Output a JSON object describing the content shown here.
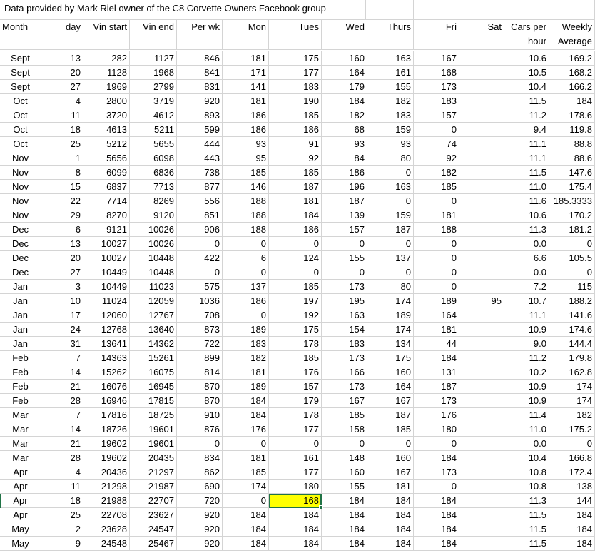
{
  "sheet": {
    "title": "Data provided by Mark Riel owner of the C8 Corvette Owners Facebook group",
    "headers": [
      "Month",
      "day",
      "Vin start",
      "Vin end",
      "Per wk",
      "Mon",
      "Tues",
      "Wed",
      "Thurs",
      "Fri",
      "Sat",
      "Cars per",
      "Weekly"
    ],
    "headers2": [
      "",
      "",
      "",
      "",
      "",
      "",
      "",
      "",
      "",
      "",
      "",
      "hour",
      "Average"
    ],
    "rows": [
      [
        "Sept",
        "13",
        "282",
        "1127",
        "846",
        "181",
        "175",
        "160",
        "163",
        "167",
        "",
        "10.6",
        "169.2"
      ],
      [
        "Sept",
        "20",
        "1128",
        "1968",
        "841",
        "171",
        "177",
        "164",
        "161",
        "168",
        "",
        "10.5",
        "168.2"
      ],
      [
        "Sept",
        "27",
        "1969",
        "2799",
        "831",
        "141",
        "183",
        "179",
        "155",
        "173",
        "",
        "10.4",
        "166.2"
      ],
      [
        "Oct",
        "4",
        "2800",
        "3719",
        "920",
        "181",
        "190",
        "184",
        "182",
        "183",
        "",
        "11.5",
        "184"
      ],
      [
        "Oct",
        "11",
        "3720",
        "4612",
        "893",
        "186",
        "185",
        "182",
        "183",
        "157",
        "",
        "11.2",
        "178.6"
      ],
      [
        "Oct",
        "18",
        "4613",
        "5211",
        "599",
        "186",
        "186",
        "68",
        "159",
        "0",
        "",
        "9.4",
        "119.8"
      ],
      [
        "Oct",
        "25",
        "5212",
        "5655",
        "444",
        "93",
        "91",
        "93",
        "93",
        "74",
        "",
        "11.1",
        "88.8"
      ],
      [
        "Nov",
        "1",
        "5656",
        "6098",
        "443",
        "95",
        "92",
        "84",
        "80",
        "92",
        "",
        "11.1",
        "88.6"
      ],
      [
        "Nov",
        "8",
        "6099",
        "6836",
        "738",
        "185",
        "185",
        "186",
        "0",
        "182",
        "",
        "11.5",
        "147.6"
      ],
      [
        "Nov",
        "15",
        "6837",
        "7713",
        "877",
        "146",
        "187",
        "196",
        "163",
        "185",
        "",
        "11.0",
        "175.4"
      ],
      [
        "Nov",
        "22",
        "7714",
        "8269",
        "556",
        "188",
        "181",
        "187",
        "0",
        "0",
        "",
        "11.6",
        "185.3333"
      ],
      [
        "Nov",
        "29",
        "8270",
        "9120",
        "851",
        "188",
        "184",
        "139",
        "159",
        "181",
        "",
        "10.6",
        "170.2"
      ],
      [
        "Dec",
        "6",
        "9121",
        "10026",
        "906",
        "188",
        "186",
        "157",
        "187",
        "188",
        "",
        "11.3",
        "181.2"
      ],
      [
        "Dec",
        "13",
        "10027",
        "10026",
        "0",
        "0",
        "0",
        "0",
        "0",
        "0",
        "",
        "0.0",
        "0"
      ],
      [
        "Dec",
        "20",
        "10027",
        "10448",
        "422",
        "6",
        "124",
        "155",
        "137",
        "0",
        "",
        "6.6",
        "105.5"
      ],
      [
        "Dec",
        "27",
        "10449",
        "10448",
        "0",
        "0",
        "0",
        "0",
        "0",
        "0",
        "",
        "0.0",
        "0"
      ],
      [
        "Jan",
        "3",
        "10449",
        "11023",
        "575",
        "137",
        "185",
        "173",
        "80",
        "0",
        "",
        "7.2",
        "115"
      ],
      [
        "Jan",
        "10",
        "11024",
        "12059",
        "1036",
        "186",
        "197",
        "195",
        "174",
        "189",
        "95",
        "10.7",
        "188.2"
      ],
      [
        "Jan",
        "17",
        "12060",
        "12767",
        "708",
        "0",
        "192",
        "163",
        "189",
        "164",
        "",
        "11.1",
        "141.6"
      ],
      [
        "Jan",
        "24",
        "12768",
        "13640",
        "873",
        "189",
        "175",
        "154",
        "174",
        "181",
        "",
        "10.9",
        "174.6"
      ],
      [
        "Jan",
        "31",
        "13641",
        "14362",
        "722",
        "183",
        "178",
        "183",
        "134",
        "44",
        "",
        "9.0",
        "144.4"
      ],
      [
        "Feb",
        "7",
        "14363",
        "15261",
        "899",
        "182",
        "185",
        "173",
        "175",
        "184",
        "",
        "11.2",
        "179.8"
      ],
      [
        "Feb",
        "14",
        "15262",
        "16075",
        "814",
        "181",
        "176",
        "166",
        "160",
        "131",
        "",
        "10.2",
        "162.8"
      ],
      [
        "Feb",
        "21",
        "16076",
        "16945",
        "870",
        "189",
        "157",
        "173",
        "164",
        "187",
        "",
        "10.9",
        "174"
      ],
      [
        "Feb",
        "28",
        "16946",
        "17815",
        "870",
        "184",
        "179",
        "167",
        "167",
        "173",
        "",
        "10.9",
        "174"
      ],
      [
        "Mar",
        "7",
        "17816",
        "18725",
        "910",
        "184",
        "178",
        "185",
        "187",
        "176",
        "",
        "11.4",
        "182"
      ],
      [
        "Mar",
        "14",
        "18726",
        "19601",
        "876",
        "176",
        "177",
        "158",
        "185",
        "180",
        "",
        "11.0",
        "175.2"
      ],
      [
        "Mar",
        "21",
        "19602",
        "19601",
        "0",
        "0",
        "0",
        "0",
        "0",
        "0",
        "",
        "0.0",
        "0"
      ],
      [
        "Mar",
        "28",
        "19602",
        "20435",
        "834",
        "181",
        "161",
        "148",
        "160",
        "184",
        "",
        "10.4",
        "166.8"
      ],
      [
        "Apr",
        "4",
        "20436",
        "21297",
        "862",
        "185",
        "177",
        "160",
        "167",
        "173",
        "",
        "10.8",
        "172.4"
      ],
      [
        "Apr",
        "11",
        "21298",
        "21987",
        "690",
        "174",
        "180",
        "155",
        "181",
        "0",
        "",
        "10.8",
        "138"
      ],
      [
        "Apr",
        "18",
        "21988",
        "22707",
        "720",
        "0",
        "168",
        "184",
        "184",
        "184",
        "",
        "11.3",
        "144"
      ],
      [
        "Apr",
        "25",
        "22708",
        "23627",
        "920",
        "184",
        "184",
        "184",
        "184",
        "184",
        "",
        "11.5",
        "184"
      ],
      [
        "May",
        "2",
        "23628",
        "24547",
        "920",
        "184",
        "184",
        "184",
        "184",
        "184",
        "",
        "11.5",
        "184"
      ],
      [
        "May",
        "9",
        "24548",
        "25467",
        "920",
        "184",
        "184",
        "184",
        "184",
        "184",
        "",
        "11.5",
        "184"
      ]
    ],
    "selected_cell": {
      "row": 31,
      "col": 6
    },
    "colors": {
      "grid": "#d4d4d4",
      "selection": "#217346",
      "highlight": "#ffff00"
    }
  }
}
